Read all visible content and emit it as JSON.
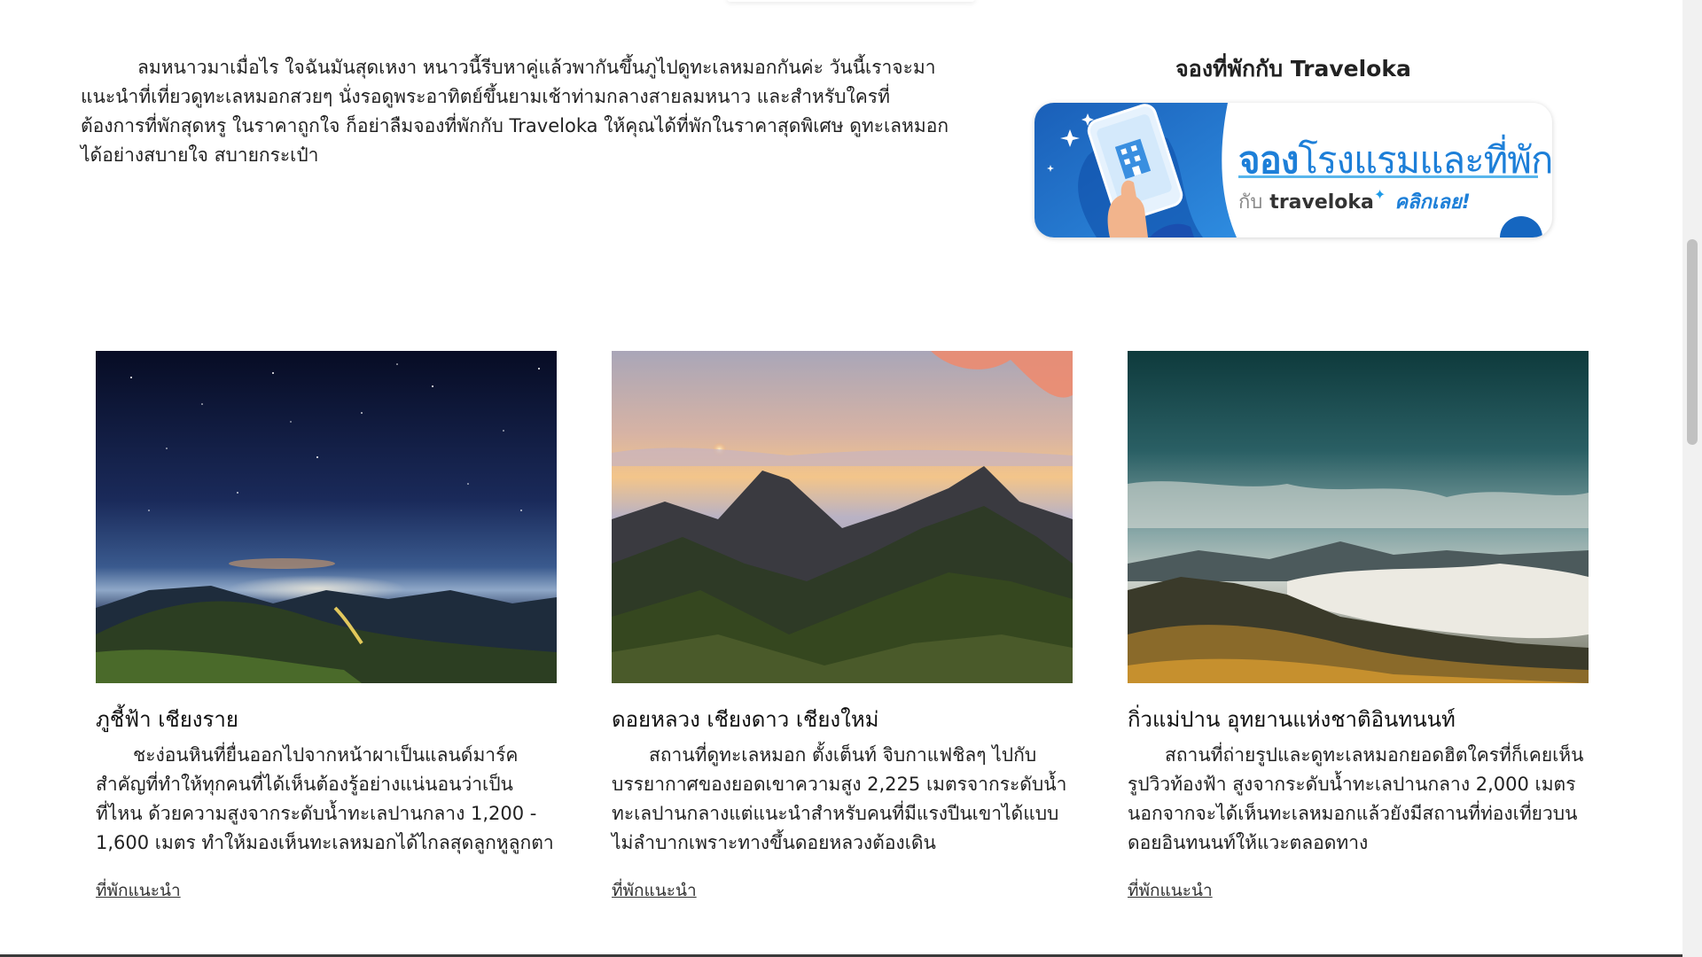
{
  "intro": {
    "text": "ลมหนาวมาเมื่อไร ใจฉันมันสุดเหงา หนาวนี้รีบหาคู่แล้วพากันขึ้นภูไปดูทะเลหมอกกันค่ะ วันนี้เราจะมาแนะนำที่เที่ยวดูทะเลหมอกสวยๆ นั่งรอดูพระอาทิตย์ขึ้นยามเช้าท่ามกลางสายลมหนาว และสำหรับใครที่ต้องการที่พักสุดหรู ในราคาถูกใจ ก็อย่าลืมจองที่พักกับ Traveloka ให้คุณได้ที่พักในราคาสุดพิเศษ ดูทะเลหมอกได้อย่างสบายใจ สบายกระเป๋า"
  },
  "booking": {
    "title": "จองที่พักกับ Traveloka",
    "banner_main_bold": "จอง",
    "banner_main_rest": "โรงแรมและที่พัก",
    "banner_with": "กับ",
    "banner_brand": "traveloka",
    "banner_cta": "คลิกเลย!"
  },
  "cards": [
    {
      "title": "ภูชี้ฟ้า เชียงราย",
      "description": "ชะง่อนหินที่ยื่นออกไปจากหน้าผาเป็นแลนด์มาร์คสำคัญที่ทำให้ทุกคนที่ได้เห็นต้องรู้อย่างแน่นอนว่าเป็นที่ไหน ด้วยความสูงจากระดับน้ำทะเลปานกลาง 1,200 - 1,600 เมตร ทำให้มองเห็นทะเลหมอกได้ไกลสุดลูกหูลูกตา",
      "link": "ที่พักแนะนำ"
    },
    {
      "title": "ดอยหลวง เชียงดาว เชียงใหม่",
      "description": "สถานที่ดูทะเลหมอก ตั้งเต็นท์ จิบกาแฟชิลๆ ไปกับบรรยากาศของยอดเขาความสูง 2,225 เมตรจากระดับน้ำทะเลปานกลางแต่แนะนำสำหรับคนที่มีแรงปีนเขาได้แบบไม่ลำบากเพราะทางขึ้นดอยหลวงต้องเดิน",
      "link": "ที่พักแนะนำ"
    },
    {
      "title": "กิ่วแม่ปาน อุทยานแห่งชาติอินทนนท์",
      "description": "สถานที่ถ่ายรูปและดูทะเลหมอกยอดฮิตใครที่ก็เคยเห็นรูปวิวท้องฟ้า สูงจากระดับน้ำทะเลปานกลาง 2,000 เมตร นอกจากจะได้เห็นทะเลหมอกแล้วยังมีสถานที่ท่องเที่ยวบนดอยอินทนนท์ให้แวะตลอดทาง",
      "link": "ที่พักแนะนำ"
    }
  ],
  "colors": {
    "banner_blue": "#1d7fd8",
    "banner_dark_blue": "#1566c0",
    "scrollbar_thumb": "#c1c1c1"
  }
}
